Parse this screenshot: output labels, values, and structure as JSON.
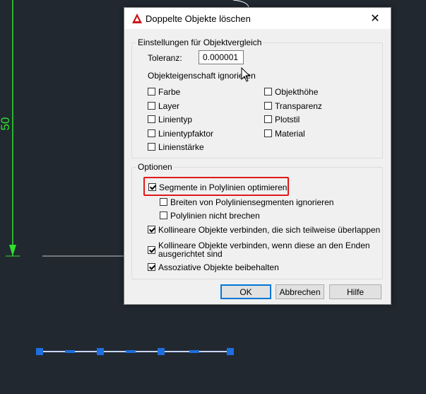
{
  "dialog": {
    "title": "Doppelte Objekte löschen",
    "close_glyph": "✕"
  },
  "settings": {
    "group_label": "Einstellungen für Objektvergleich",
    "tolerance_label": "Toleranz:",
    "tolerance_value": "0.000001",
    "ignore_label": "Objekteigenschaft ignorieren",
    "properties_left": [
      {
        "label": "Farbe",
        "checked": false
      },
      {
        "label": "Layer",
        "checked": false
      },
      {
        "label": "Linientyp",
        "checked": false
      },
      {
        "label": "Linientypfaktor",
        "checked": false
      },
      {
        "label": "Linienstärke",
        "checked": false
      }
    ],
    "properties_right": [
      {
        "label": "Objekthöhe",
        "checked": false
      },
      {
        "label": "Transparenz",
        "checked": false
      },
      {
        "label": "Plotstil",
        "checked": false
      },
      {
        "label": "Material",
        "checked": false
      }
    ]
  },
  "options": {
    "group_label": "Optionen",
    "optimize_segments": {
      "label": "Segmente in Polylinien optimieren",
      "checked": true
    },
    "ignore_widths": {
      "label": "Breiten von Polyliniensegmenten ignorieren",
      "checked": false
    },
    "no_break": {
      "label": "Polylinien nicht brechen",
      "checked": false
    },
    "merge_overlapping": {
      "label": "Kollineare Objekte verbinden, die sich teilweise überlappen",
      "checked": true
    },
    "merge_ends": {
      "label_line1": "Kollineare Objekte verbinden, wenn diese an den Enden",
      "label_line2": "ausgerichtet sind",
      "checked": true
    },
    "keep_associative": {
      "label": "Assoziative Objekte beibehalten",
      "checked": true
    }
  },
  "buttons": {
    "ok": "OK",
    "cancel": "Abbrechen",
    "help": "Hilfe"
  },
  "cad": {
    "dimension_text": "50",
    "dimension_color": "#2ee02e",
    "grip_color": "#1e6fe0"
  }
}
